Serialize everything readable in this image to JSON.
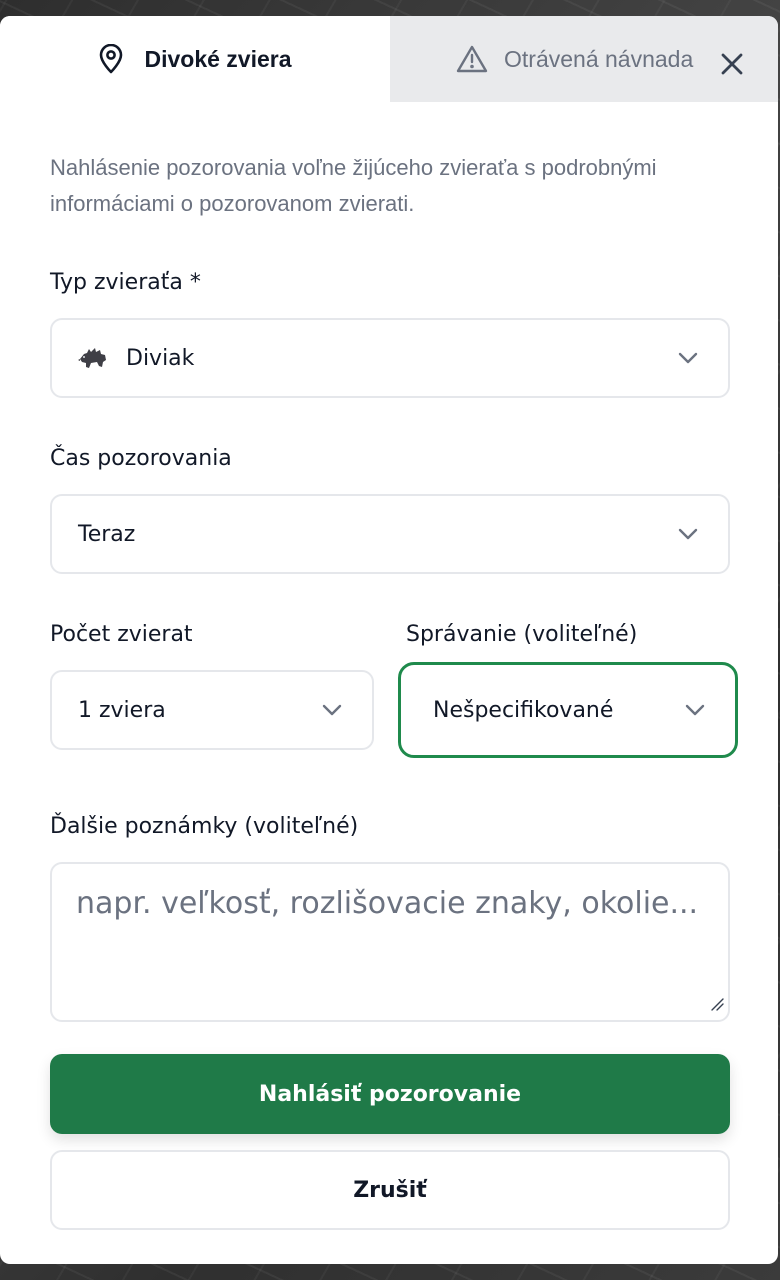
{
  "tabs": {
    "active_label": "Divoké zviera",
    "inactive_label": "Otrávená návnada",
    "active_icon": "map-pin-icon",
    "inactive_icon": "warning-triangle-icon"
  },
  "description": "Nahlásenie pozorovania voľne žijúceho zvieraťa s podrobnými informáciami o pozorovanom zvierati.",
  "animal_type": {
    "label": "Typ zvieraťa *",
    "value": "Diviak",
    "icon": "boar-icon"
  },
  "observation_time": {
    "label": "Čas pozorovania",
    "value": "Teraz"
  },
  "animal_count": {
    "label": "Počet zvierat",
    "value": "1 zviera"
  },
  "behavior": {
    "label": "Správanie (voliteľné)",
    "value": "Nešpecifikované"
  },
  "notes": {
    "label": "Ďalšie poznámky (voliteľné)",
    "placeholder": "napr. veľkosť, rozlišovacie znaky, okolie..."
  },
  "buttons": {
    "submit": "Nahlásiť pozorovanie",
    "cancel": "Zrušiť"
  },
  "colors": {
    "primary": "#1f7a48",
    "focus": "#1f8a4c",
    "muted_text": "#6b7280"
  }
}
